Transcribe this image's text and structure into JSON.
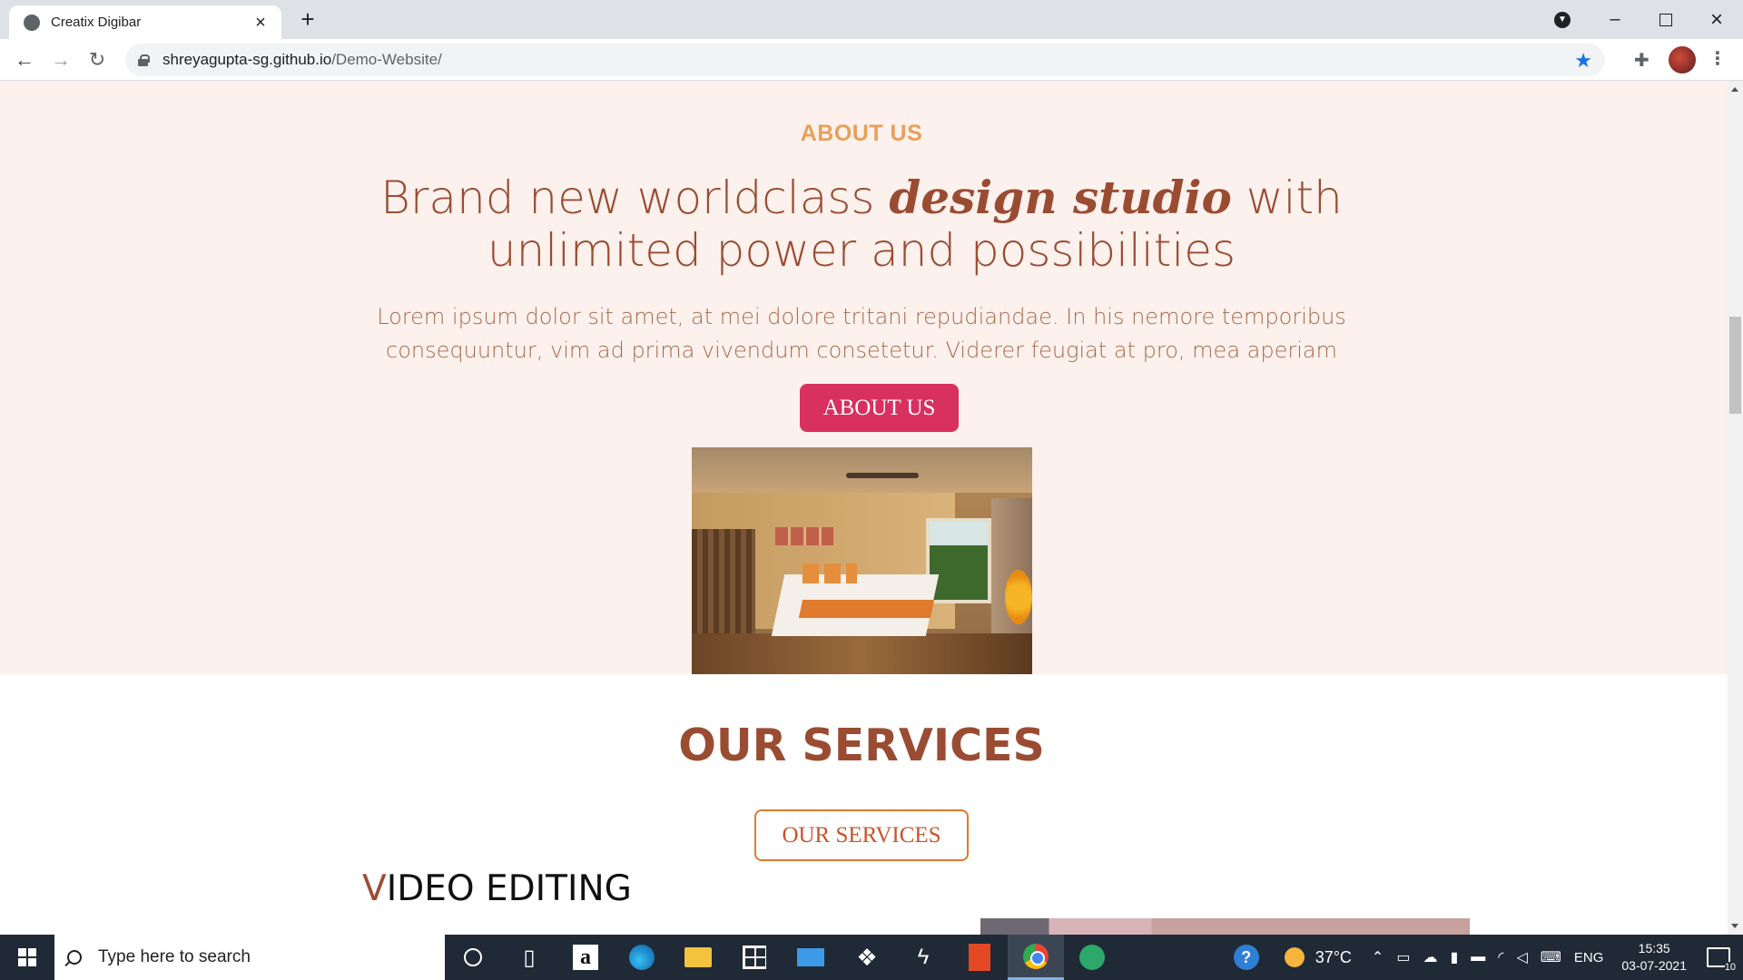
{
  "browser": {
    "tab_title": "Creatix Digibar",
    "url_host": "shreyagupta-sg.github.io",
    "url_path": "/Demo-Website/"
  },
  "about": {
    "eyebrow": "ABOUT US",
    "heading_pre": "Brand new worldclass ",
    "heading_em": "design studio",
    "heading_post": " with unlimited power and possibilities",
    "text": "Lorem ipsum dolor sit amet, at mei dolore tritani repudiandae. In his nemore temporibus consequuntur, vim ad prima vivendum consetetur. Viderer feugiat at pro, mea aperiam",
    "button_label": "ABOUT US"
  },
  "services": {
    "title": "OUR SERVICES",
    "button_label": "OUR SERVICES",
    "video_first": "V",
    "video_rest": "IDEO EDITING"
  },
  "taskbar": {
    "search_placeholder": "Type here to search",
    "amazon_letter": "a",
    "help_symbol": "?",
    "temperature": "37°C",
    "language": "ENG",
    "time": "15:35",
    "date": "03-07-2021",
    "notification_count": "10"
  },
  "colors": {
    "accent_brown": "#9a4c33",
    "about_bg": "#fcf1ec",
    "button_pink": "#d8305f",
    "eyebrow_orange": "#e7a05c",
    "outline_orange": "#e07a2c"
  }
}
